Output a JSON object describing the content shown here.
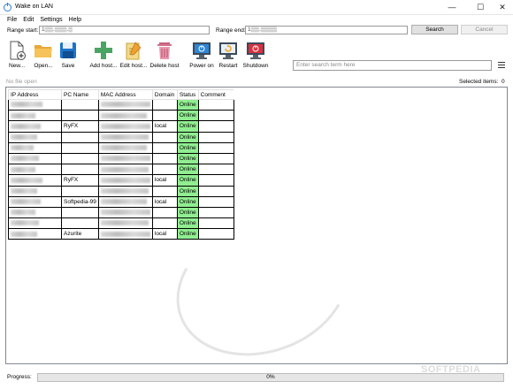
{
  "window": {
    "title": "Wake on LAN"
  },
  "menu": [
    "File",
    "Edit",
    "Settings",
    "Help"
  ],
  "range": {
    "start_label": "Range start:",
    "start_value": "1▒▒.▒▒▒.▒",
    "end_label": "Range end:",
    "end_value": "1▒▒.▒▒▒▒",
    "search_button": "Search",
    "cancel_button": "Cancel"
  },
  "toolbar": {
    "new": "New...",
    "open": "Open...",
    "save": "Save",
    "add_host": "Add host...",
    "edit_host": "Edit host...",
    "delete_host": "Delete host",
    "power_on": "Power on",
    "restart": "Restart",
    "shutdown": "Shutdown",
    "search_placeholder": "Enter search term here"
  },
  "status": {
    "file_status": "No file open",
    "selected_label": "Selected items:",
    "selected_count": "0"
  },
  "table": {
    "headers": [
      "IP Address",
      "PC Name",
      "MAC Address",
      "Domain",
      "Status",
      "Comment"
    ],
    "rows": [
      {
        "pc": "",
        "domain": "",
        "status": "Online"
      },
      {
        "pc": "",
        "domain": "",
        "status": "Online"
      },
      {
        "pc": "RyFX",
        "domain": "local",
        "status": "Online"
      },
      {
        "pc": "",
        "domain": "",
        "status": "Online"
      },
      {
        "pc": "",
        "domain": "",
        "status": "Online"
      },
      {
        "pc": "",
        "domain": "",
        "status": "Online"
      },
      {
        "pc": "",
        "domain": "",
        "status": "Online"
      },
      {
        "pc": "RyFX",
        "domain": "local",
        "status": "Online"
      },
      {
        "pc": "",
        "domain": "",
        "status": "Online"
      },
      {
        "pc": "Softpedia-99",
        "domain": "local",
        "status": "Online"
      },
      {
        "pc": "",
        "domain": "",
        "status": "Online"
      },
      {
        "pc": "",
        "domain": "",
        "status": "Online"
      },
      {
        "pc": "Azurite",
        "domain": "local",
        "status": "Online"
      }
    ]
  },
  "progress": {
    "label": "Progress:",
    "text": "0%",
    "value": 0
  },
  "watermark": "SOFTPEDIA",
  "colors": {
    "online": "#90ee90",
    "accent": "#2f7fd8",
    "progress": "#06b025"
  }
}
